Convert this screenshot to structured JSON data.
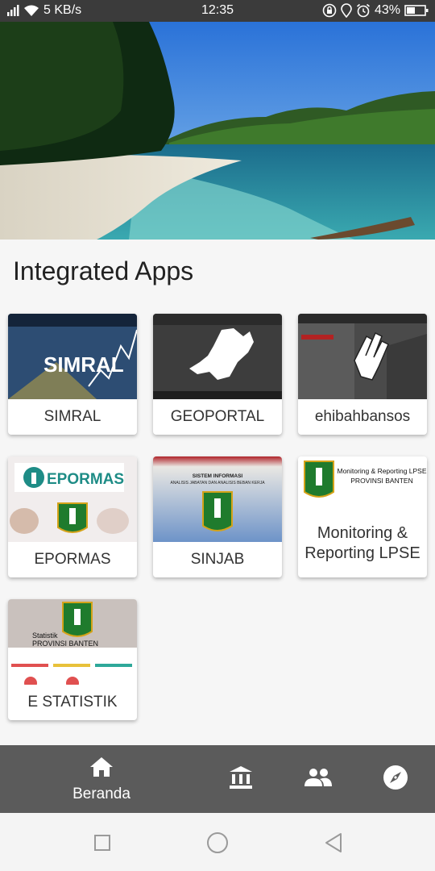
{
  "status_bar": {
    "signal": "4G",
    "speed": "5 KB/s",
    "time": "12:35",
    "battery": "43%"
  },
  "section_title": "Integrated Apps",
  "apps": [
    {
      "label": "SIMRAL"
    },
    {
      "label": "GEOPORTAL"
    },
    {
      "label": "ehibahbansos"
    },
    {
      "label": "EPORMAS"
    },
    {
      "label": "SINJAB"
    },
    {
      "label": "Monitoring & Reporting LPSE",
      "thumb_caption_1": "Monitoring & Reporting LPSE",
      "thumb_caption_2": "PROVINSI BANTEN"
    },
    {
      "label": "E STATISTIK",
      "thumb_caption_1": "Statistik",
      "thumb_caption_2": "PROVINSI BANTEN"
    }
  ],
  "thumb_text": {
    "simral": "SIMRAL",
    "epormas": "EPORMAS",
    "sinjab_1": "SISTEM INFORMASI",
    "sinjab_2": "ANALISIS JABATAN DAN ANALISIS BEBAN KERJA",
    "banten": "BANTEN"
  },
  "bottom_nav": {
    "home": "Beranda",
    "icons": [
      "home-icon",
      "institution-icon",
      "people-icon",
      "compass-icon"
    ]
  },
  "colors": {
    "nav_bg": "#5b5b5b",
    "status_bg": "#3b3b3b",
    "card_bg": "#ffffff",
    "page_bg": "#f6f6f6"
  }
}
